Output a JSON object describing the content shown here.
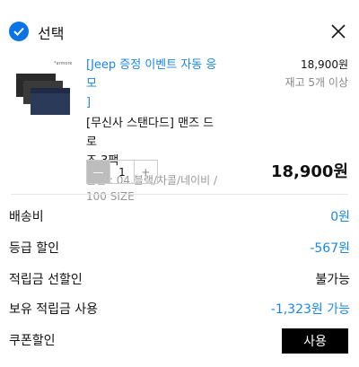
{
  "header": {
    "select_label": "선택"
  },
  "product": {
    "brand_label": "*armored",
    "promo_line1": "[Jeep 증정 이벤트 자동 응모",
    "promo_line2": "]",
    "name_line1": "[무신사 스탠다드] 맨즈 드로",
    "name_line2": "즈 3팩",
    "option_line1": "옵션 : 04.블랙/차콜/네이비 /",
    "option_line2": "100 SIZE",
    "unit_price": "18,900원",
    "stock": "재고 5개 이상",
    "quantity": "1",
    "total_price": "18,900원"
  },
  "summary": [
    {
      "label": "배송비",
      "value": "0원",
      "accent": true
    },
    {
      "label": "등급 할인",
      "value": "-567원",
      "accent": true
    },
    {
      "label": "적립금 선할인",
      "value": "불가능",
      "accent": false
    },
    {
      "label": "보유 적립금 사용",
      "value": "-1,323원 가능",
      "accent": true
    },
    {
      "label": "쿠폰할인",
      "value": "",
      "accent": false
    }
  ],
  "coupon_button": "사용",
  "colors": {
    "accent": "#1a87e8",
    "check": "#0a73e6"
  }
}
